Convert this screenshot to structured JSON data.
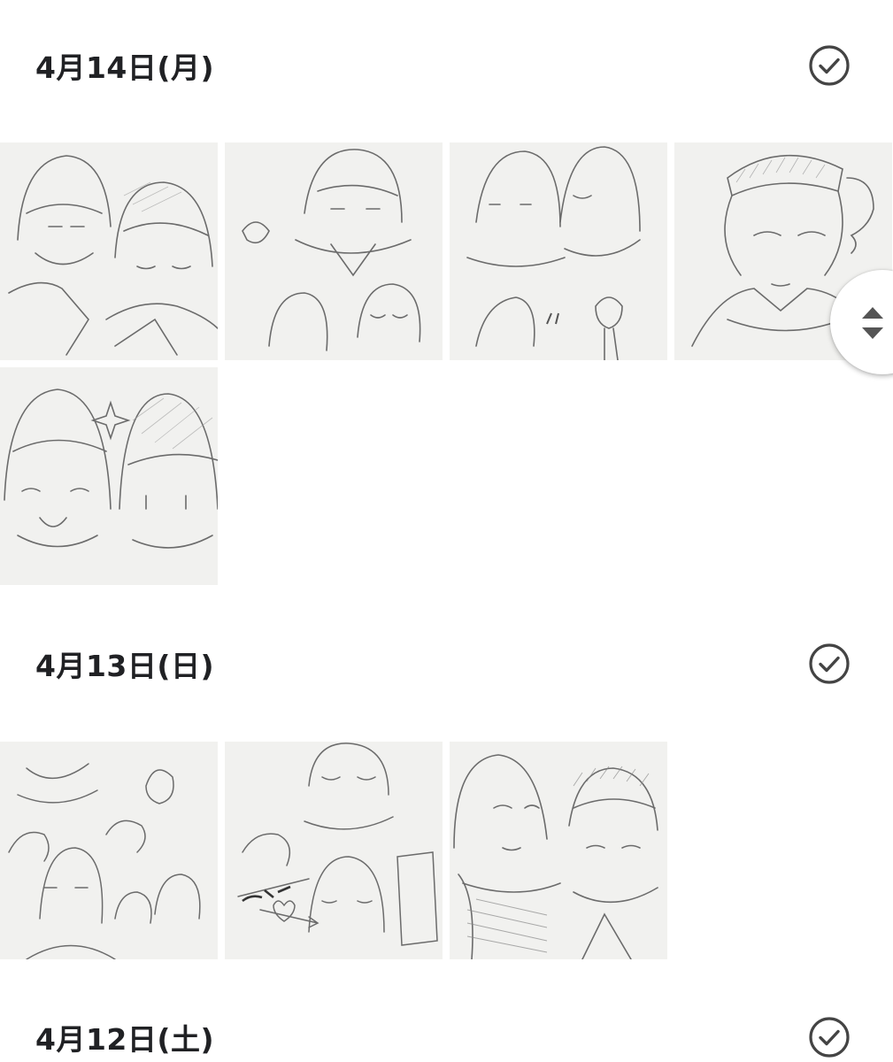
{
  "sections": [
    {
      "date_label": "4月14日(月)",
      "select_icon": "check-circle-outline-icon",
      "photo_count": 5
    },
    {
      "date_label": "4月13日(日)",
      "select_icon": "check-circle-outline-icon",
      "photo_count": 3
    },
    {
      "date_label": "4月12日(土)",
      "select_icon": "check-circle-outline-icon",
      "photo_count": 0
    }
  ],
  "photos": [
    {
      "alt": "pencil sketch of two girls",
      "section": 0
    },
    {
      "alt": "pencil sketch of girls and hands",
      "section": 0
    },
    {
      "alt": "pencil sketch of two girls leaning",
      "section": 0
    },
    {
      "alt": "pencil sketch of girl in knit cap",
      "section": 0
    },
    {
      "alt": "pencil sketch chibi faces",
      "section": 0
    },
    {
      "alt": "pencil sketch of several girls",
      "section": 1
    },
    {
      "alt": "pencil sketch with heart arrow",
      "section": 1
    },
    {
      "alt": "pencil sketch of two girls portrait",
      "section": 1
    }
  ],
  "scroll_handle": {
    "icon": "up-down-arrows-icon"
  },
  "colors": {
    "text": "#202124",
    "icon": "#444444",
    "thumb_paper": "#f1f1ef",
    "pencil": "#6b6b6b"
  }
}
